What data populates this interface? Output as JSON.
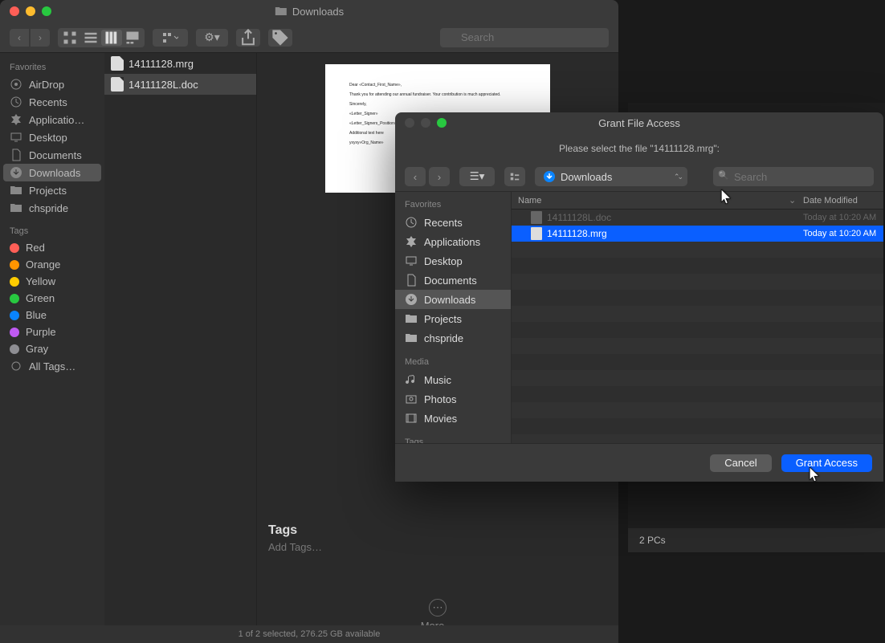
{
  "finder": {
    "title": "Downloads",
    "search_placeholder": "Search",
    "sidebar": {
      "favorites_label": "Favorites",
      "tags_label": "Tags",
      "favorites": [
        "AirDrop",
        "Recents",
        "Applicatio…",
        "Desktop",
        "Documents",
        "Downloads",
        "Projects",
        "chspride"
      ],
      "tags": [
        {
          "label": "Red",
          "color": "#ff5f57"
        },
        {
          "label": "Orange",
          "color": "#ff9500"
        },
        {
          "label": "Yellow",
          "color": "#ffcc00"
        },
        {
          "label": "Green",
          "color": "#28c840"
        },
        {
          "label": "Blue",
          "color": "#0a84ff"
        },
        {
          "label": "Purple",
          "color": "#bf5af2"
        },
        {
          "label": "Gray",
          "color": "#8e8e93"
        }
      ],
      "all_tags": "All Tags…"
    },
    "files": [
      {
        "name": "14111128.mrg"
      },
      {
        "name": "14111128L.doc"
      }
    ],
    "preview_lines": [
      "Dear «Contact_First_Name»,",
      "Thank you for attending our annual fundraiser. Your contribution is much appreciated.",
      "Sincerely,",
      "«Letter_Signer»",
      "«Letter_Signers_Position»",
      "",
      "Additional text here",
      "yxyxy«Org_Name»"
    ],
    "tags_title": "Tags",
    "tags_add": "Add Tags…",
    "more_label": "More…",
    "status": "1 of 2 selected, 276.25 GB available"
  },
  "modal": {
    "title": "Grant File Access",
    "prompt": "Please select the file \"14111128.mrg\":",
    "location": "Downloads",
    "search_placeholder": "Search",
    "sidebar": {
      "favorites_label": "Favorites",
      "favorites": [
        "Recents",
        "Applications",
        "Desktop",
        "Documents",
        "Downloads",
        "Projects",
        "chspride"
      ],
      "media_label": "Media",
      "media": [
        "Music",
        "Photos",
        "Movies"
      ],
      "tags_label": "Tags"
    },
    "columns": {
      "name": "Name",
      "date": "Date Modified"
    },
    "rows": [
      {
        "name": "14111128L.doc",
        "date": "Today at 10:20 AM",
        "disabled": true,
        "selected": false
      },
      {
        "name": "14111128.mrg",
        "date": "Today at 10:20 AM",
        "disabled": false,
        "selected": true
      }
    ],
    "cancel": "Cancel",
    "grant": "Grant Access"
  },
  "side": {
    "footer": "2 PCs"
  }
}
